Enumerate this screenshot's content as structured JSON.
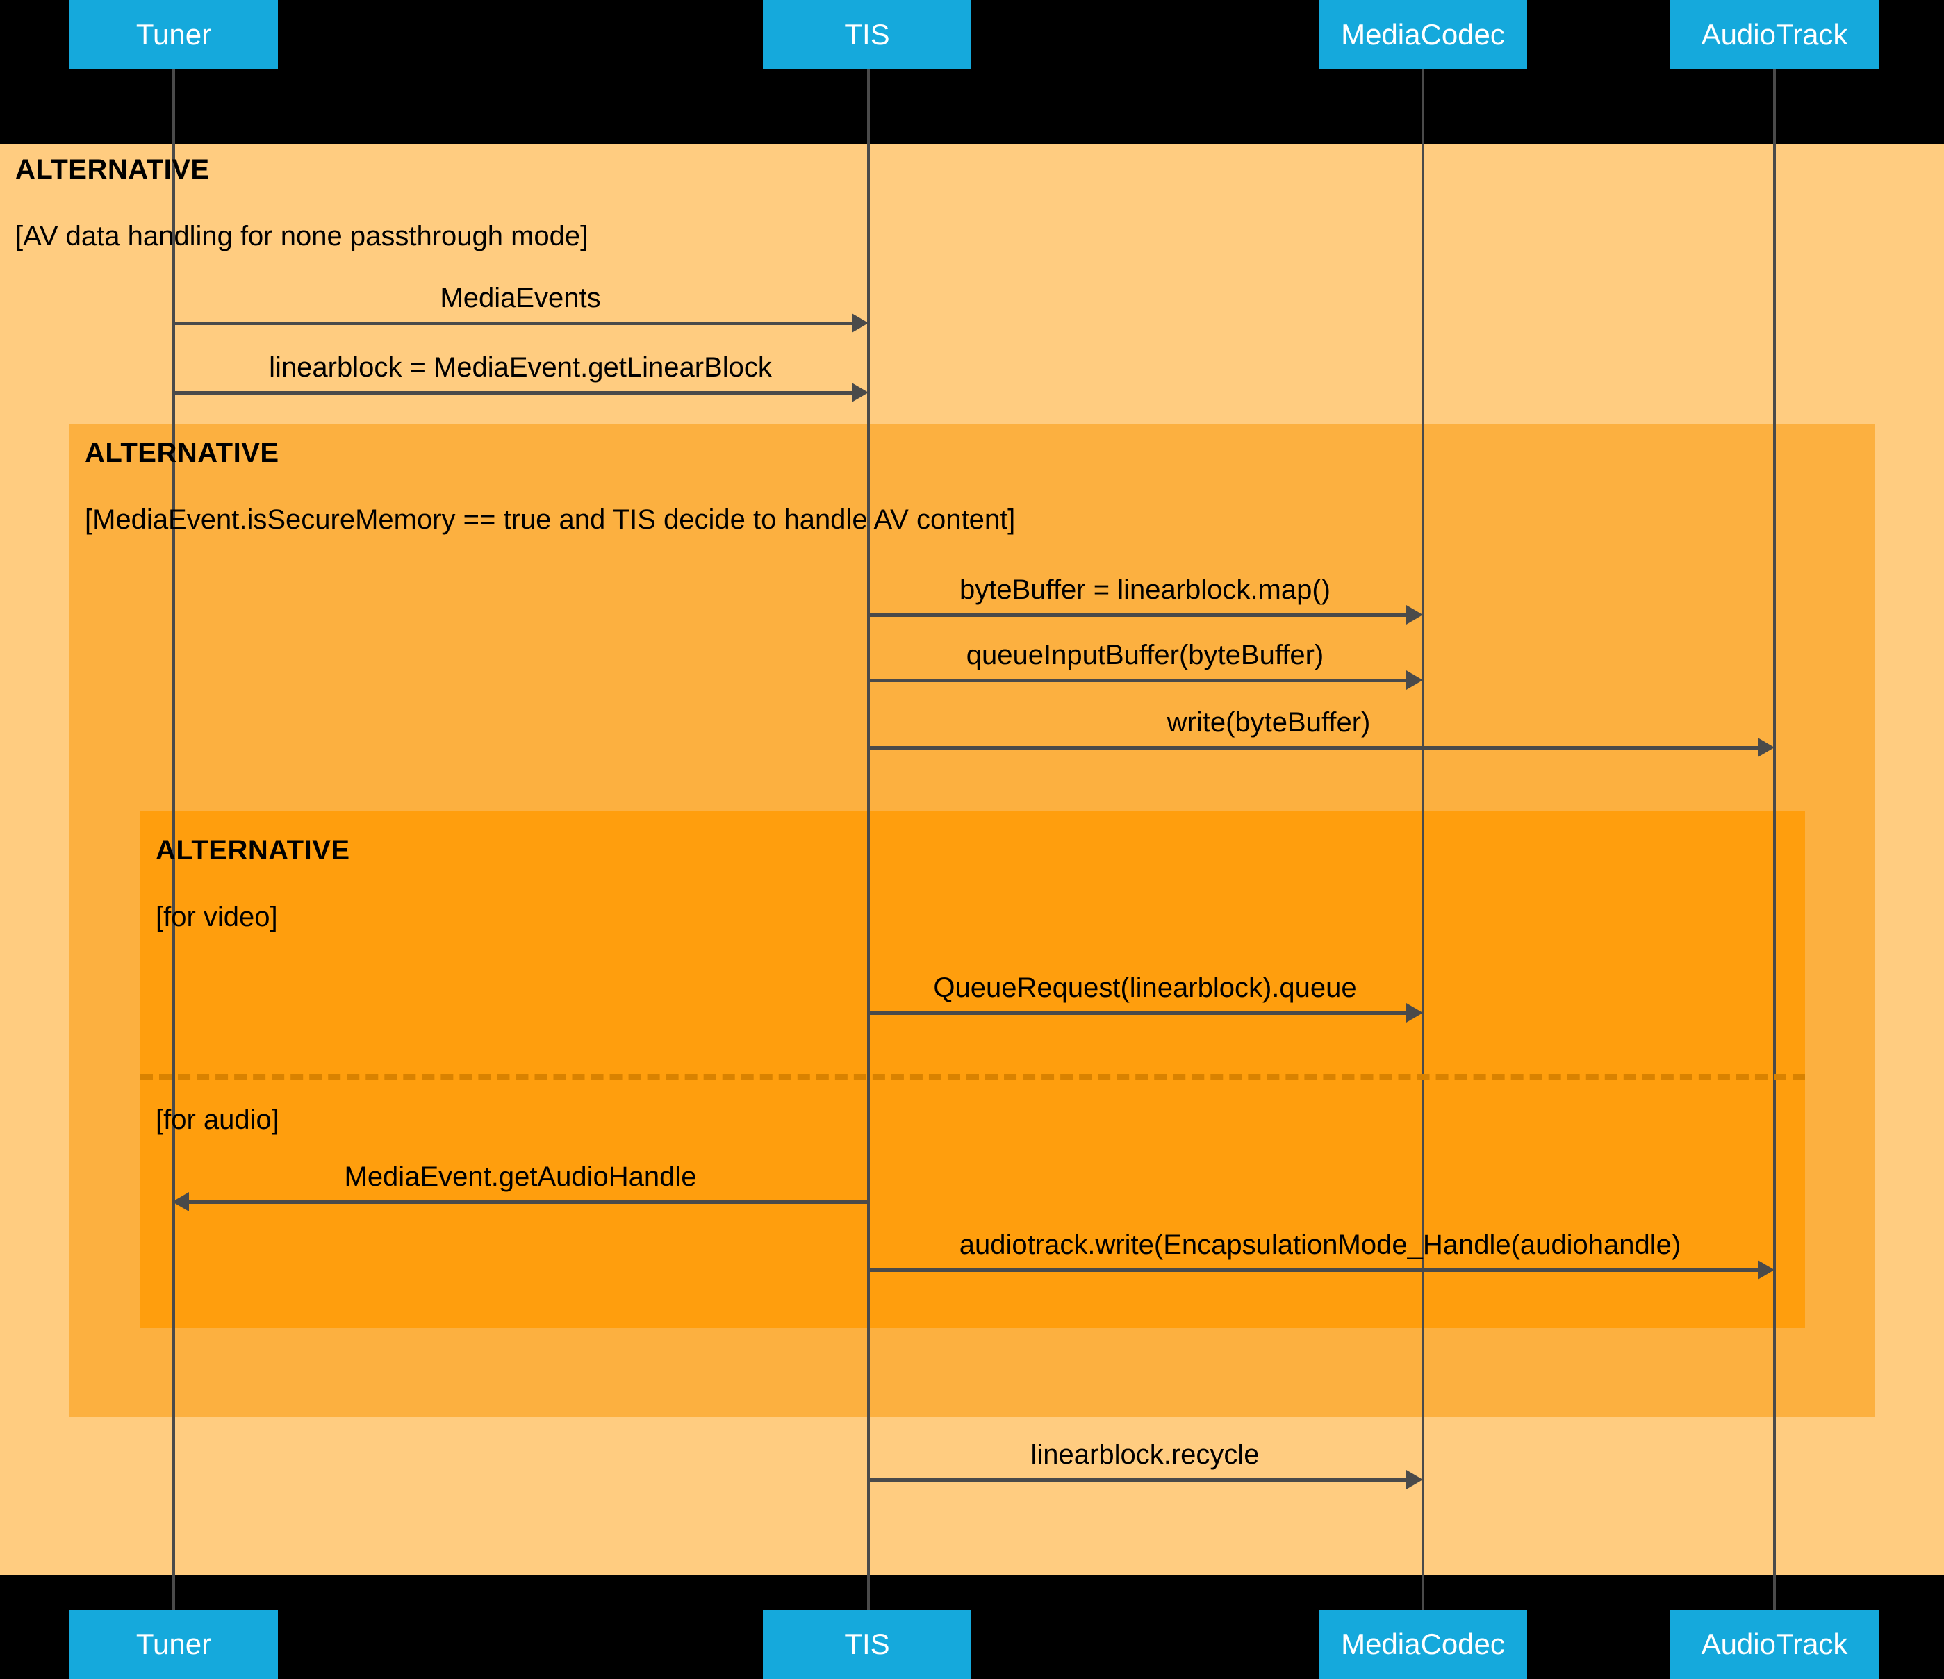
{
  "diagram": {
    "type": "uml-sequence-diagram",
    "background_color": "#000000",
    "participant_color": "#15A9DC",
    "participant_text_color": "#FFFFFF",
    "line_color": "#4A4A4A",
    "frame_colors": [
      "#FFCC80",
      "#FCB040",
      "#FF9E0D"
    ],
    "divider_color": "#D98200"
  },
  "participants": [
    {
      "id": "tuner",
      "label": "Tuner"
    },
    {
      "id": "tis",
      "label": "TIS"
    },
    {
      "id": "mediacodec",
      "label": "MediaCodec"
    },
    {
      "id": "audiotrack",
      "label": "AudioTrack"
    }
  ],
  "participants_bottom": [
    {
      "id": "tuner",
      "label": "Tuner"
    },
    {
      "id": "tis",
      "label": "TIS"
    },
    {
      "id": "mediacodec",
      "label": "MediaCodec"
    },
    {
      "id": "audiotrack",
      "label": "AudioTrack"
    }
  ],
  "frames": [
    {
      "id": "alt-outer",
      "title": "ALTERNATIVE",
      "guard": "[AV data handling for none passthrough mode]"
    },
    {
      "id": "alt-middle",
      "title": "ALTERNATIVE",
      "guard": "[MediaEvent.isSecureMemory == true and TIS decide to handle AV content]"
    },
    {
      "id": "alt-inner",
      "title": "ALTERNATIVE",
      "guard": "[for video]",
      "guard2": "[for audio]"
    }
  ],
  "messages": [
    {
      "id": "m1",
      "label": "MediaEvents",
      "from": "tuner",
      "to": "tis",
      "direction": "right"
    },
    {
      "id": "m2",
      "label": "linearblock = MediaEvent.getLinearBlock",
      "from": "tuner",
      "to": "tis",
      "direction": "right"
    },
    {
      "id": "m3",
      "label": "byteBuffer = linearblock.map()",
      "from": "tis",
      "to": "mediacodec",
      "direction": "right"
    },
    {
      "id": "m4",
      "label": "queueInputBuffer(byteBuffer)",
      "from": "tis",
      "to": "mediacodec",
      "direction": "right"
    },
    {
      "id": "m5",
      "label": "write(byteBuffer)",
      "from": "tis",
      "to": "audiotrack",
      "direction": "right"
    },
    {
      "id": "m6",
      "label": "QueueRequest(linearblock).queue",
      "from": "tis",
      "to": "mediacodec",
      "direction": "right"
    },
    {
      "id": "m7",
      "label": "MediaEvent.getAudioHandle",
      "from": "tis",
      "to": "tuner",
      "direction": "left"
    },
    {
      "id": "m8",
      "label": "audiotrack.write(EncapsulationMode_Handle(audiohandle)",
      "from": "tis",
      "to": "audiotrack",
      "direction": "right"
    },
    {
      "id": "m9",
      "label": "linearblock.recycle",
      "from": "tis",
      "to": "mediacodec",
      "direction": "right"
    }
  ]
}
